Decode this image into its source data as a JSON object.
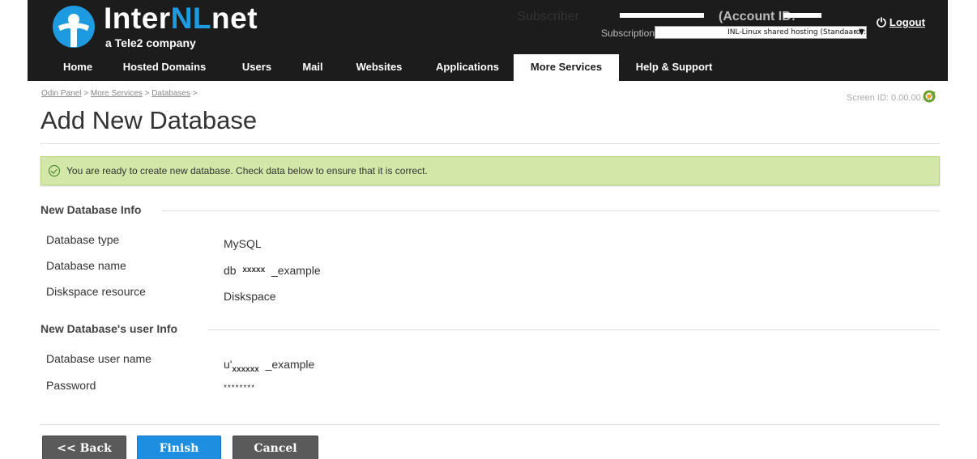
{
  "brand": {
    "name_part1": "Inter",
    "name_part2": "NL",
    "name_part3": "net",
    "tagline": "a Tele2 company",
    "accent_color": "#1e9be0"
  },
  "account": {
    "subscriber_label": "Subscriber",
    "account_id_label": "(Account ID:",
    "subscription_label": "Subscription",
    "subscription_value": "INL-Linux shared hosting (Standaard):",
    "logout_label": "Logout",
    "logout_icon": "power-icon"
  },
  "nav": {
    "items": [
      {
        "label": "Home"
      },
      {
        "label": "Hosted Domains"
      },
      {
        "label": "Users"
      },
      {
        "label": "Mail"
      },
      {
        "label": "Websites"
      },
      {
        "label": "Applications"
      },
      {
        "label": "More Services",
        "active": true
      },
      {
        "label": "Help & Support"
      }
    ]
  },
  "breadcrumb": {
    "items": [
      "Odin Panel",
      "More Services",
      "Databases"
    ],
    "separator": ">"
  },
  "screen_id": "Screen ID: 0.00.00.00",
  "page_title": "Add New Database",
  "alert": {
    "text": "You are ready to create new database. Check data below to ensure that it is correct.",
    "color": "#d3e8a8"
  },
  "section_db": {
    "title": "New Database Info",
    "fields": [
      {
        "label": "Database type",
        "value": "MySQL"
      },
      {
        "label": "Database name",
        "value_prefix": "db",
        "value_masked": "xxxxx",
        "value_suffix": "_example"
      },
      {
        "label": "Diskspace resource",
        "value": "Diskspace"
      }
    ]
  },
  "section_user": {
    "title": "New Database's user Info",
    "fields": [
      {
        "label": "Database user name",
        "value_prefix": "u'",
        "value_masked": "xxxxxx",
        "value_suffix": "_example"
      },
      {
        "label": "Password",
        "value": "********"
      }
    ]
  },
  "buttons": {
    "back": "<< Back",
    "finish": "Finish",
    "cancel": "Cancel"
  }
}
